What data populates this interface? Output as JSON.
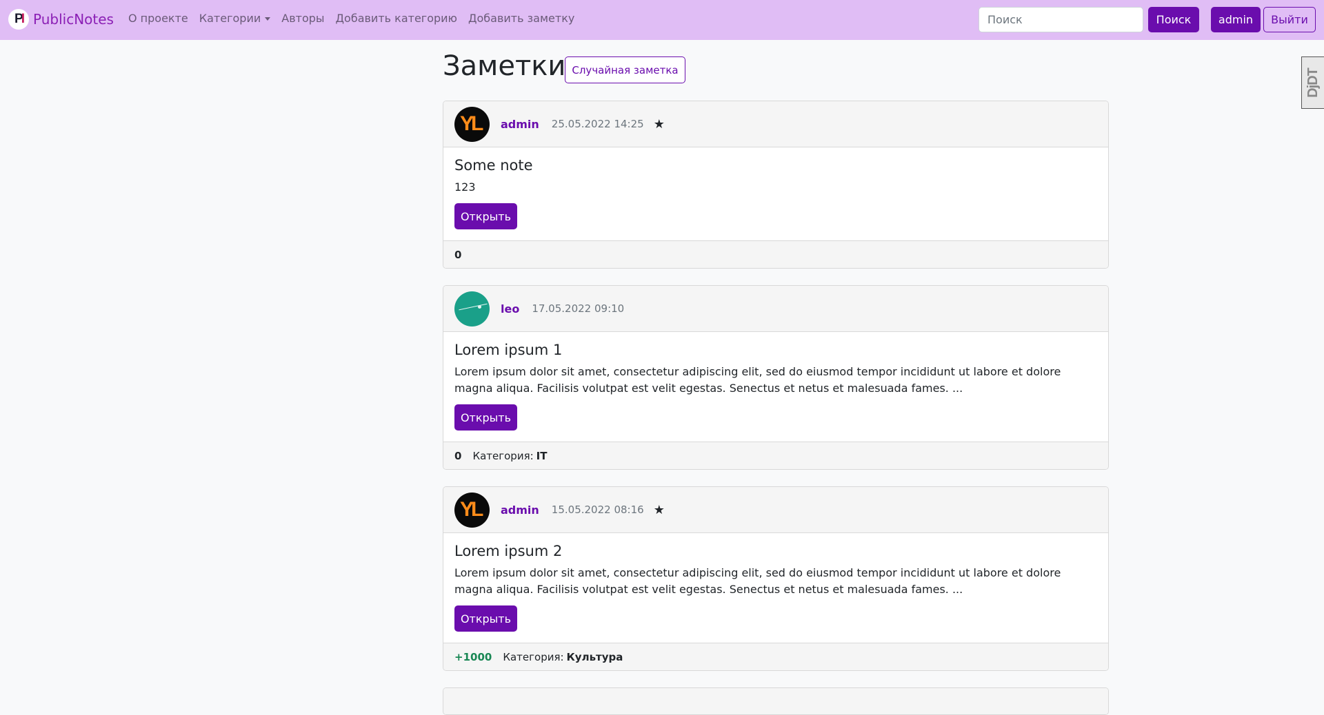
{
  "navbar": {
    "brand_name": "PublicNotes",
    "logo_letters": "P",
    "logo_letters_accent": "I",
    "links": [
      {
        "label": "О проекте"
      },
      {
        "label": "Категории"
      },
      {
        "label": "Авторы"
      },
      {
        "label": "Добавить категорию"
      },
      {
        "label": "Добавить заметку"
      }
    ],
    "search_placeholder": "Поиск",
    "search_label": "Поиск",
    "user_label": "admin",
    "logout_label": "Выйти",
    "accent_color": "#6a0dad",
    "bg_color": "#e0bdf5"
  },
  "darkreader_tab": "DjDT",
  "main": {
    "title": "Заметки",
    "random_label": "Случайная заметка"
  },
  "notes": [
    {
      "author": "admin",
      "date": "25.05.2022 14:25",
      "star": "★",
      "title": "Some note",
      "text": "123",
      "open_label": "Открыть",
      "score": "0",
      "category_label": "",
      "category": ""
    },
    {
      "author": "leo",
      "date": "17.05.2022 09:10",
      "star": "",
      "title": "Lorem ipsum 1",
      "text": "Lorem ipsum dolor sit amet, consectetur adipiscing elit, sed do eiusmod tempor incididunt ut labore et dolore magna aliqua. Facilisis volutpat est velit egestas. Senectus et netus et malesuada fames. ...",
      "open_label": "Открыть",
      "score": "0",
      "category_label": "Категория:",
      "category": "IT"
    },
    {
      "author": "admin",
      "date": "15.05.2022 08:16",
      "star": "★",
      "title": "Lorem ipsum 2",
      "text": "Lorem ipsum dolor sit amet, consectetur adipiscing elit, sed do eiusmod tempor incididunt ut labore et dolore magna aliqua. Facilisis volutpat est velit egestas. Senectus et netus et malesuada fames. ...",
      "open_label": "Открыть",
      "score": "+1000",
      "category_label": "Категория:",
      "category": "Культура"
    }
  ]
}
